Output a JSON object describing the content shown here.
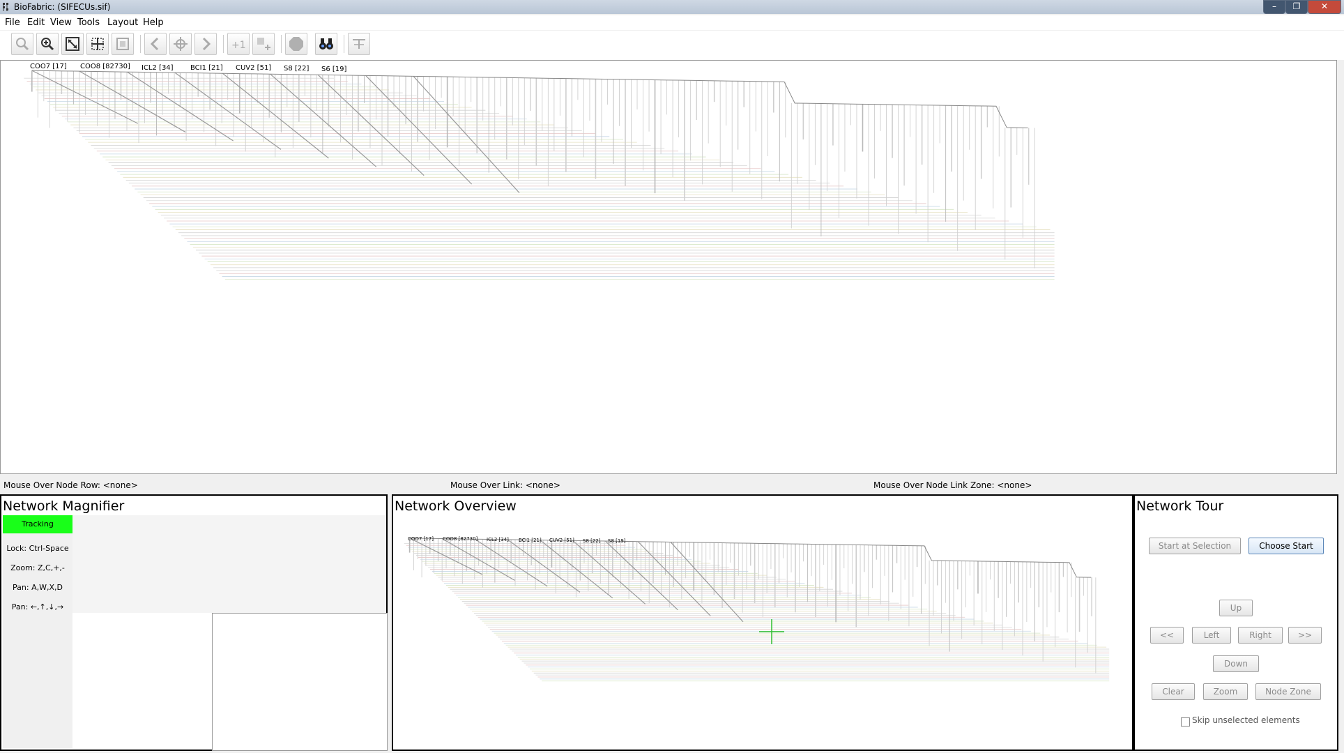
{
  "window": {
    "title": "BioFabric: (SIFECUs.sif)",
    "controls": {
      "minimize": "–",
      "maximize": "❐",
      "close": "✕"
    }
  },
  "menu": {
    "items": [
      "File",
      "Edit",
      "View",
      "Tools",
      "Layout",
      "Help"
    ]
  },
  "toolbar": {
    "buttons": [
      "zoom-out",
      "zoom-in",
      "zoom-to-model",
      "zoom-to-selection",
      "zoom-to-rect",
      "back",
      "center-on-selection",
      "forward",
      "add-first-neighbors",
      "clear-selections",
      "stop",
      "search",
      "tour-settings"
    ]
  },
  "main": {
    "node_labels": [
      "COO7 [17]",
      "COO8 [82730]",
      "ICL2 [34]",
      "BCI1 [21]",
      "CUV2 [51]",
      "S8 [22]",
      "S6 [19]"
    ]
  },
  "status": {
    "node_row": "Mouse Over Node Row: <none>",
    "link": "Mouse Over Link: <none>",
    "link_zone": "Mouse Over Node Link Zone: <none>"
  },
  "magnifier": {
    "title": "Network Magnifier",
    "tracking": "Tracking",
    "hints": [
      "Lock: Ctrl-Space",
      "Zoom: Z,C,+,-",
      "Pan: A,W,X,D",
      "Pan: ←,↑,↓,→"
    ]
  },
  "overview": {
    "title": "Network Overview",
    "node_labels": [
      "COO7 [17]",
      "COO8 [82730]",
      "ICL2 [34]",
      "BCI1 [21]",
      "CUV2 [51]",
      "S8 [22]",
      "S8 [19]"
    ]
  },
  "tour": {
    "title": "Network Tour",
    "start_at_selection": "Start at Selection",
    "choose_start": "Choose Start",
    "up": "Up",
    "prev": "<<",
    "left": "Left",
    "right": "Right",
    "next": ">>",
    "down": "Down",
    "clear": "Clear",
    "zoom": "Zoom",
    "node_zone": "Node Zone",
    "skip_label": "Skip unselected elements"
  }
}
